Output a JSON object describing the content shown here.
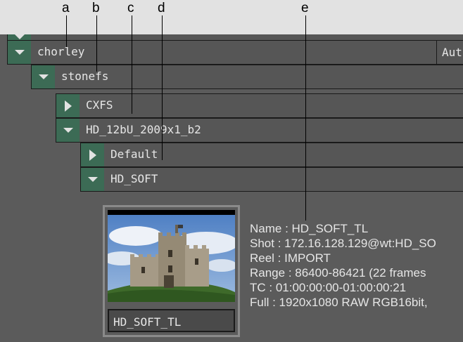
{
  "callouts": [
    "a",
    "b",
    "c",
    "d",
    "e"
  ],
  "tree": {
    "top_partial": {
      "label": ""
    },
    "chorley": {
      "label": "chorley",
      "extra": "Aut",
      "expanded": true
    },
    "stonefs": {
      "label": "stonefs",
      "expanded": true
    },
    "cxfs": {
      "label": "CXFS",
      "expanded": false
    },
    "hd12bu": {
      "label": "HD_12bU_2009x1_b2",
      "expanded": true
    },
    "default": {
      "label": "Default",
      "expanded": false
    },
    "hdsoft": {
      "label": "HD_SOFT",
      "expanded": true
    }
  },
  "clip": {
    "name": "HD_SOFT_TL",
    "thumbnail": "castle-thumbnail",
    "info": [
      "Name : HD_SOFT_TL",
      "Shot : 172.16.128.129@wt:HD_SO",
      "Reel : IMPORT",
      "Range : 86400-86421 (22 frames",
      "TC : 01:00:00:00-01:00:00:21",
      "Full : 1920x1080  RAW RGB16bit,"
    ]
  },
  "colors": {
    "background": "#5b5b5b",
    "row": "#565656",
    "toggle": "#3c6b55",
    "text": "#e6e6e6",
    "callout_band": "#e2e2e2"
  }
}
